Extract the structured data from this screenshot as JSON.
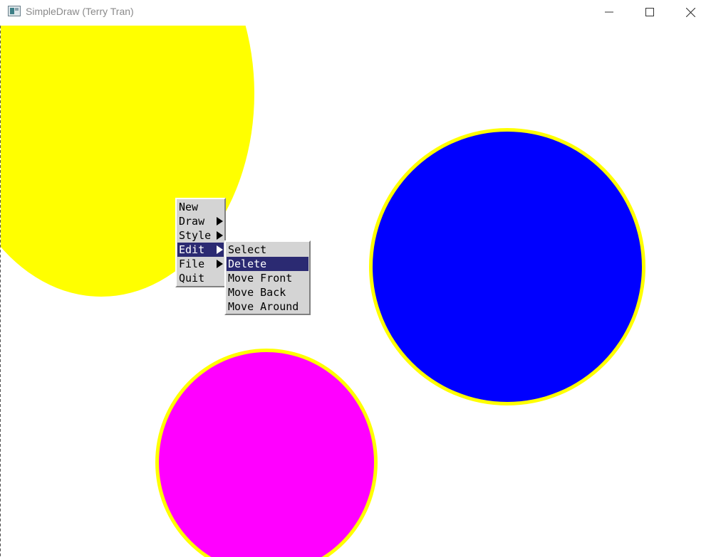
{
  "window": {
    "title": "SimpleDraw (Terry Tran)",
    "icon": "app-window-icon",
    "controls": [
      "minimize-icon",
      "maximize-icon",
      "close-icon"
    ]
  },
  "canvas": {
    "background": "#ffffff",
    "shapes": [
      {
        "name": "yellow-circle",
        "fill": "#ffff00",
        "outline": "#ffff00"
      },
      {
        "name": "blue-circle",
        "fill": "#0000ff",
        "outline": "#ffff00"
      },
      {
        "name": "magenta-circle",
        "fill": "#ff00ff",
        "outline": "#ffff00"
      }
    ]
  },
  "context_menu": {
    "items": [
      {
        "label": "New",
        "has_submenu": false
      },
      {
        "label": "Draw",
        "has_submenu": true
      },
      {
        "label": "Style",
        "has_submenu": true
      },
      {
        "label": "Edit",
        "has_submenu": true,
        "highlighted": true
      },
      {
        "label": "File",
        "has_submenu": true
      },
      {
        "label": "Quit",
        "has_submenu": false
      }
    ],
    "highlight_color": "#2b2a72"
  },
  "edit_submenu": {
    "items": [
      {
        "label": "Select"
      },
      {
        "label": "Delete",
        "highlighted": true
      },
      {
        "label": "Move Front"
      },
      {
        "label": "Move Back"
      },
      {
        "label": "Move Around"
      }
    ]
  }
}
